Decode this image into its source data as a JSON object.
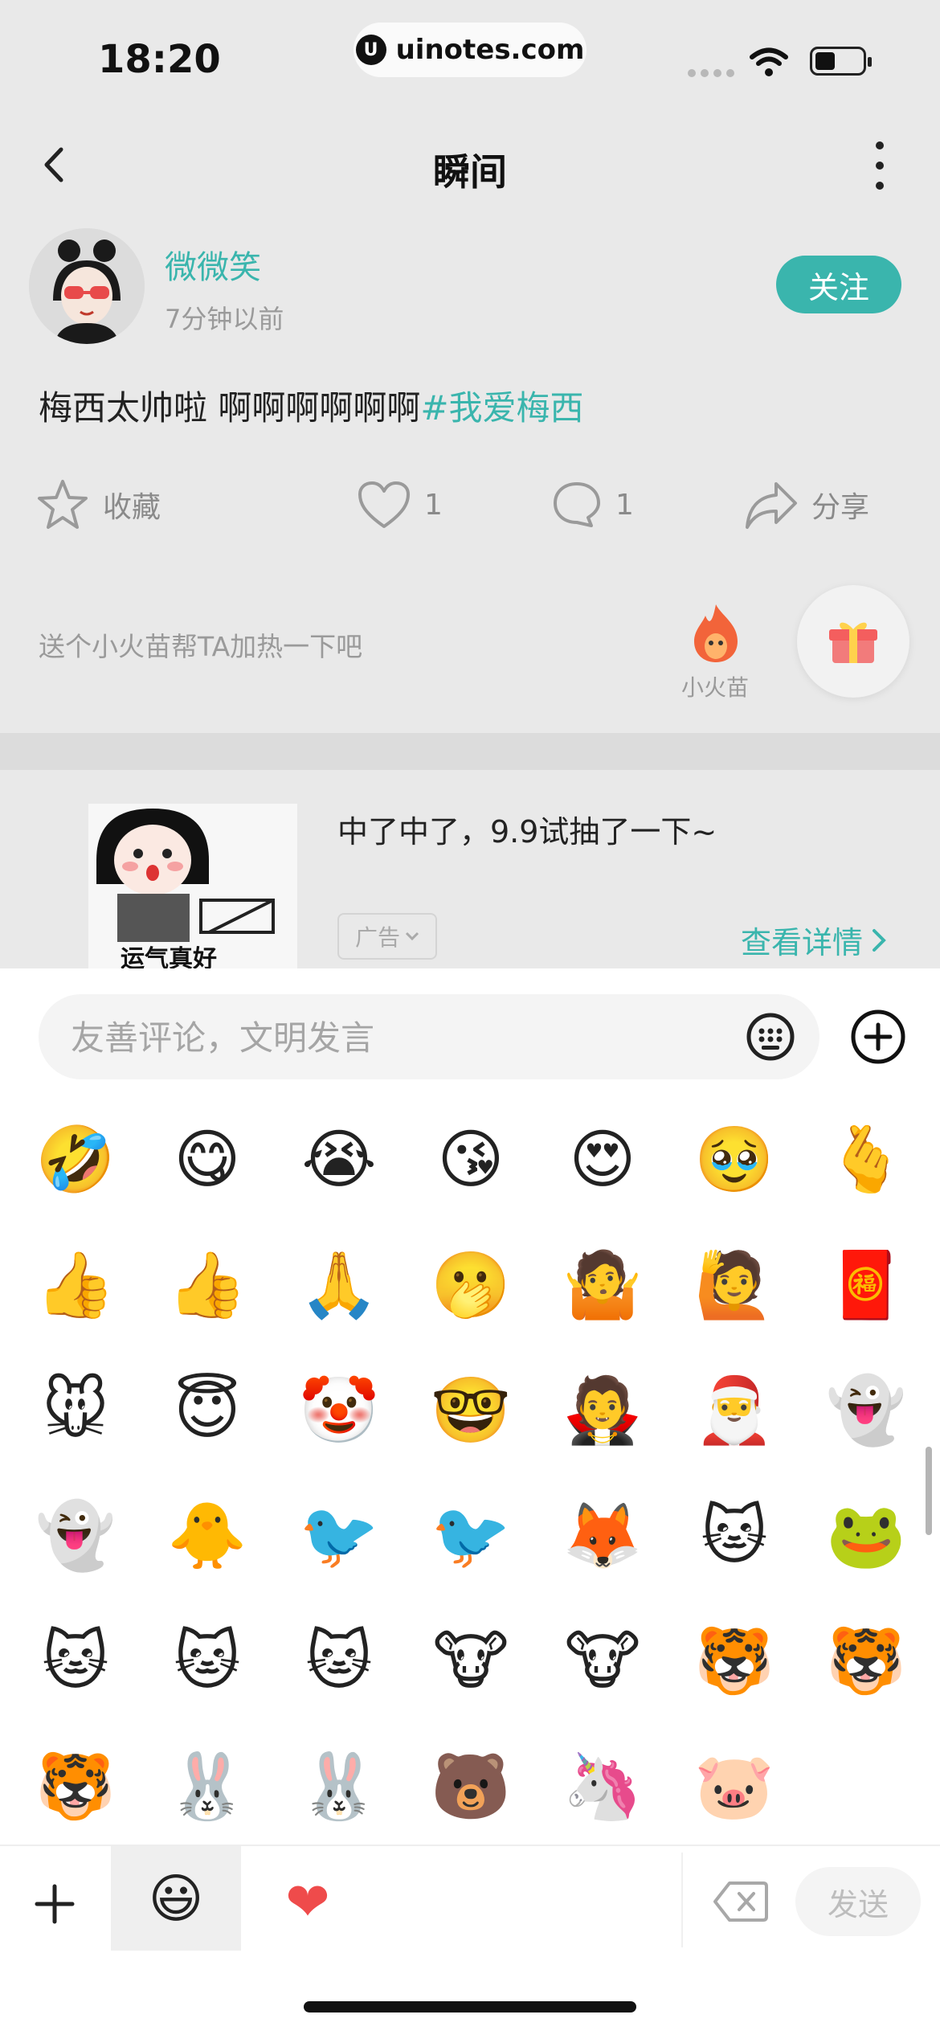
{
  "status_bar": {
    "time": "18:20",
    "url": "uinotes.com",
    "url_logo": "U"
  },
  "nav": {
    "title": "瞬间"
  },
  "post": {
    "username": "微微笑",
    "time_ago": "7分钟以前",
    "follow_label": "关注",
    "text": "梅西太帅啦 啊啊啊啊啊啊",
    "hashtag": "#我爱梅西",
    "actions": {
      "collect_label": "收藏",
      "like_count": "1",
      "comment_count": "1",
      "share_label": "分享"
    },
    "boost_text": "送个小火苗帮TA加热一下吧",
    "flame_label": "小火苗"
  },
  "ad": {
    "title": "中了中了，9.9试抽了一下~",
    "tag": "广告",
    "link_label": "查看详情",
    "thumb_caption": "运气真好"
  },
  "comment": {
    "placeholder": "友善评论，文明发言",
    "send_label": "发送"
  },
  "emojis": [
    "🤣",
    "😋",
    "😭",
    "😘",
    "😍",
    "🥹",
    "🫰",
    "👍",
    "👍",
    "🙏",
    "🫢",
    "🤷",
    "🙋",
    "🧧",
    "🐭",
    "😇",
    "🤡",
    "🤓",
    "🧛",
    "🎅",
    "👻",
    "👻",
    "🐥",
    "🐦",
    "🐦",
    "🦊",
    "🐱",
    "🐸",
    "🐱",
    "🐱",
    "🐱",
    "🐮",
    "🐮",
    "🐯",
    "🐯",
    "🐯",
    "🐰",
    "🐰",
    "🐻",
    "🦄",
    "🐷"
  ],
  "toolbar": {
    "emoji_tab": "😃",
    "heart_tab": "❤"
  },
  "colors": {
    "accent": "#3ab5ad",
    "heart": "#ef4b4b"
  }
}
